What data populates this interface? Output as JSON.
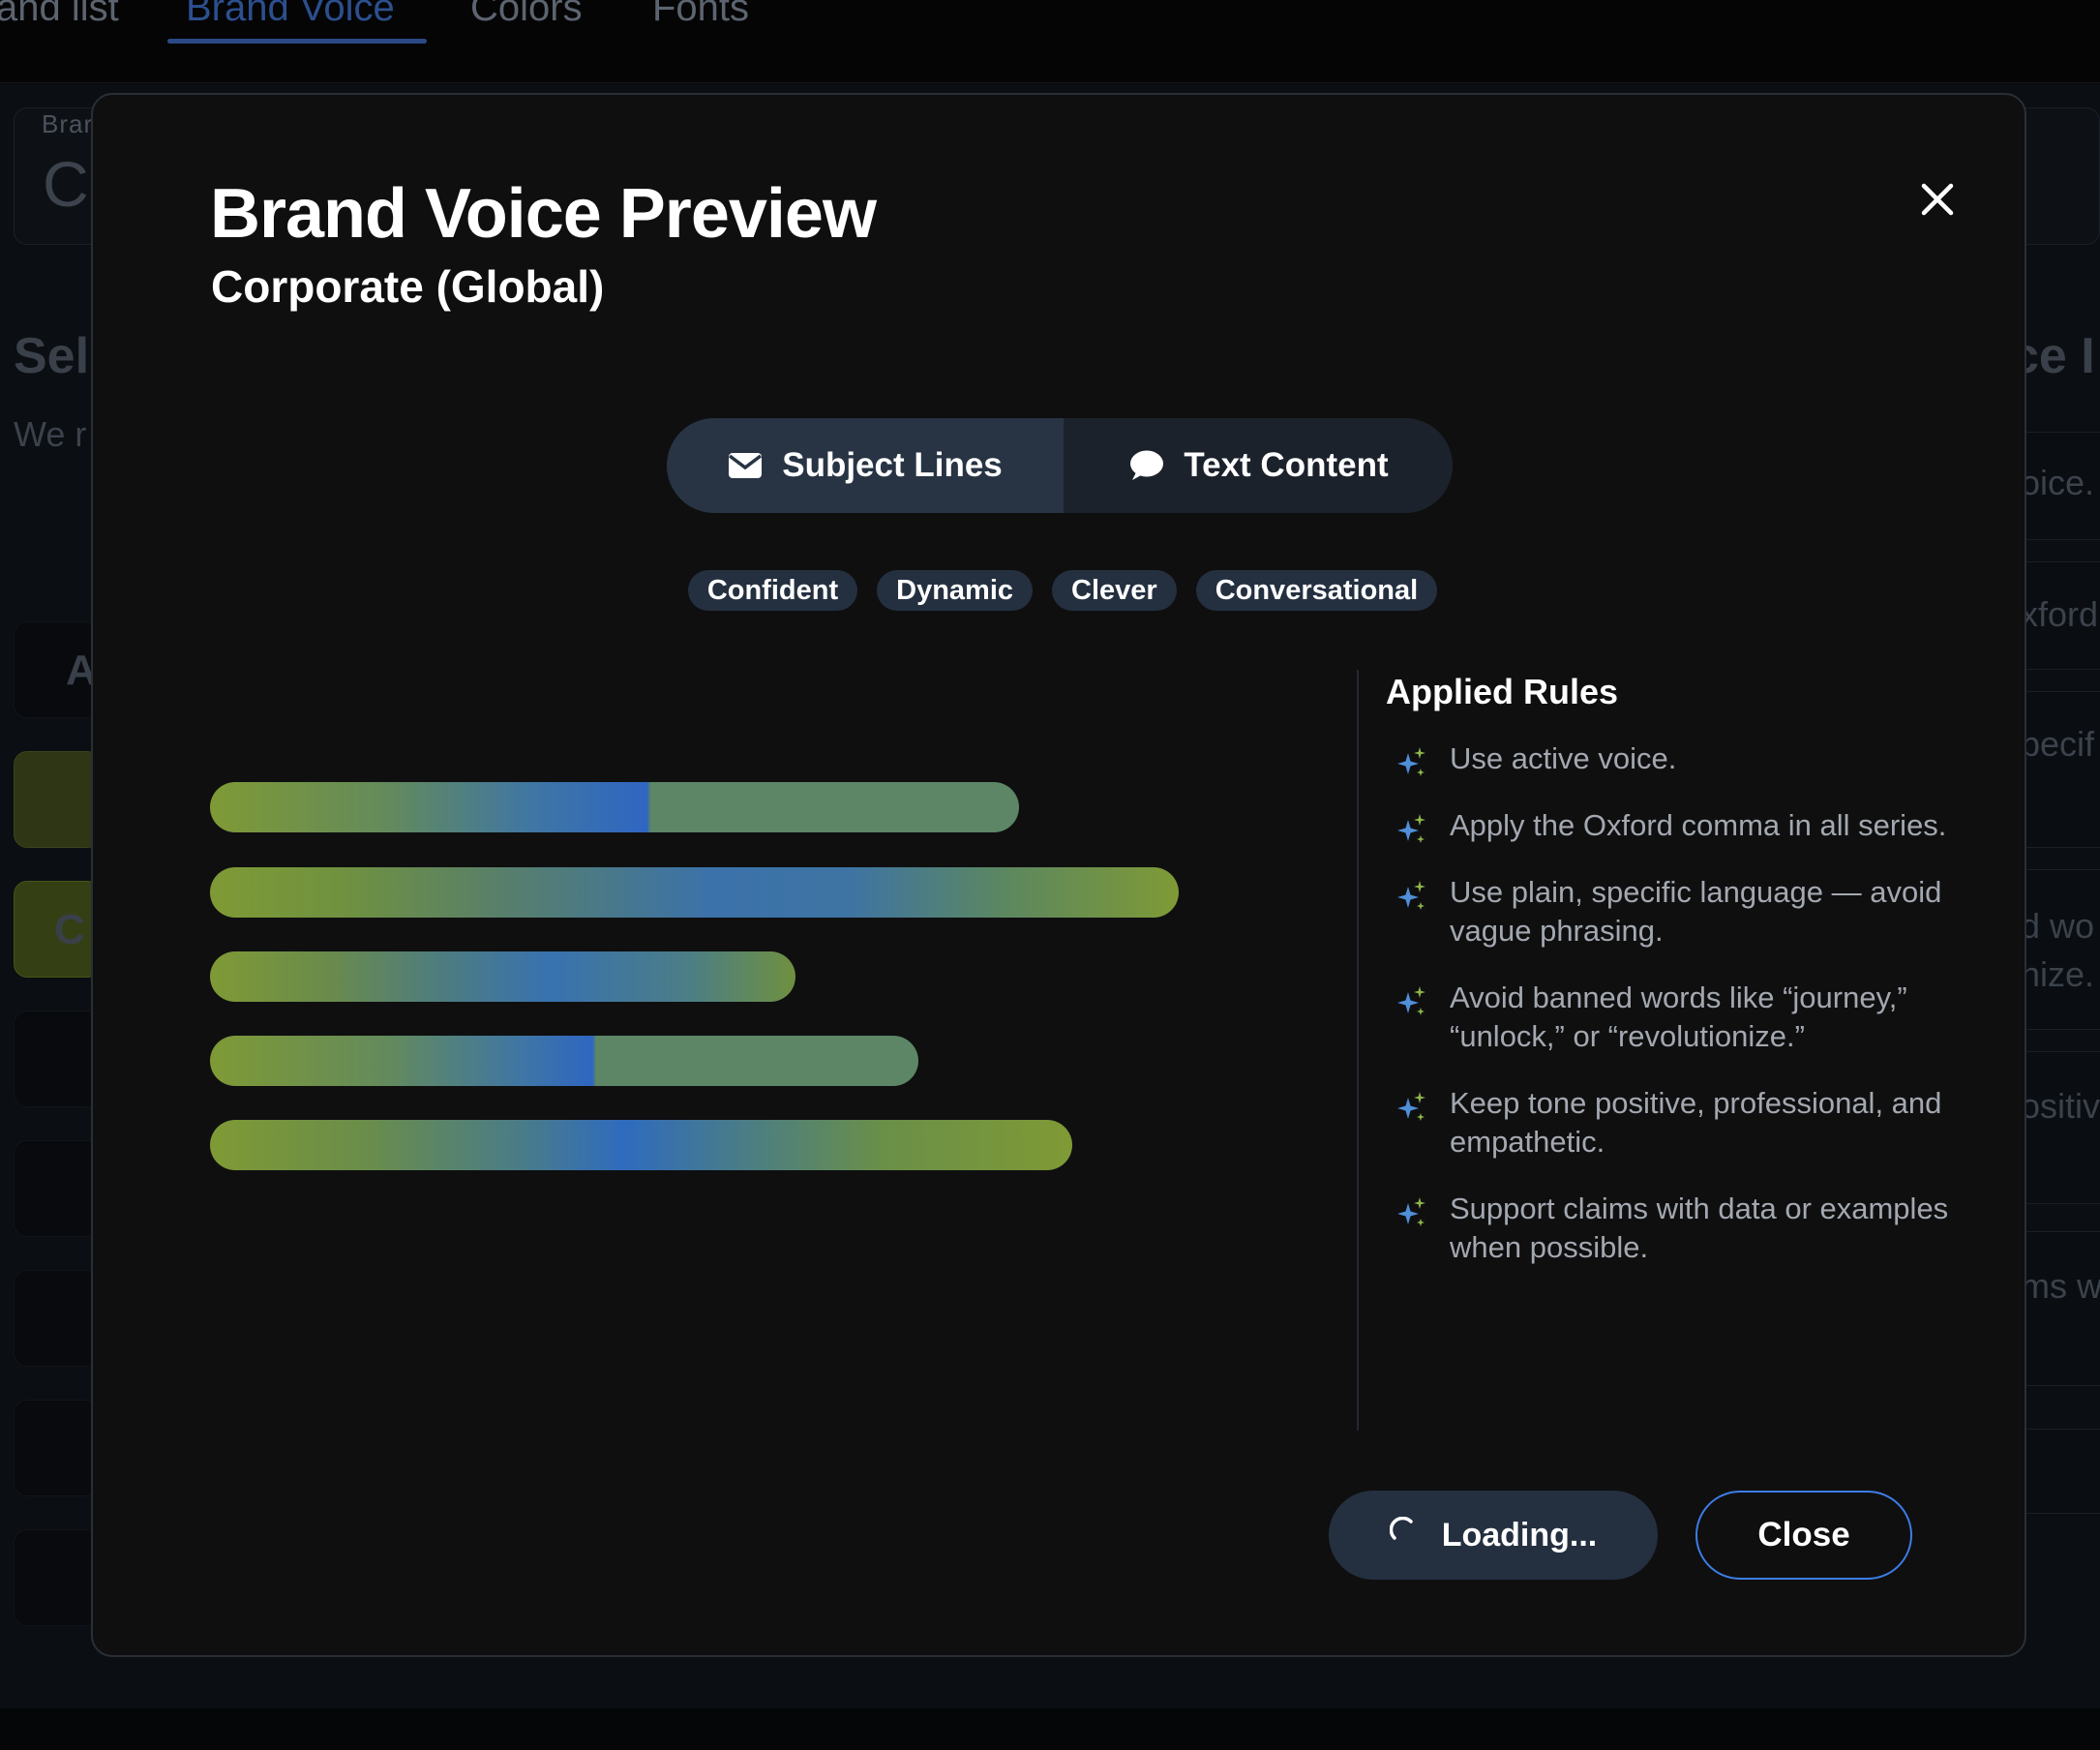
{
  "background": {
    "nav_tabs": [
      {
        "label": "and list"
      },
      {
        "label": "Brand Voice"
      },
      {
        "label": "Colors"
      },
      {
        "label": "Fonts"
      }
    ],
    "card_label": "Brar",
    "card_value": "C",
    "left_heading": "Sel",
    "left_text": "We r",
    "right_heading": "ce I",
    "list_letters": [
      "A",
      "C"
    ],
    "right_rows": [
      "oice.",
      "xford",
      "pecif",
      "d wo",
      "nize.",
      "ositiv",
      "ms w"
    ]
  },
  "modal": {
    "title": "Brand Voice Preview",
    "subtitle": "Corporate (Global)",
    "tabs": [
      {
        "label": "Subject Lines",
        "icon": "envelope-icon",
        "selected": true
      },
      {
        "label": "Text Content",
        "icon": "speech-bubble-icon",
        "selected": false
      }
    ],
    "chips": [
      "Confident",
      "Dynamic",
      "Clever",
      "Conversational"
    ],
    "skeleton_bars": [
      0.76,
      0.91,
      0.55,
      0.665,
      0.81
    ],
    "rules_title": "Applied Rules",
    "rules": [
      "Use active voice.",
      "Apply the Oxford comma in all series.",
      "Use plain, specific language — avoid vague phrasing.",
      "Avoid banned words like “journey,” “unlock,” or “revolutionize.”",
      "Keep tone positive, professional, and empathetic.",
      "Support claims with data or examples when possible."
    ],
    "loading_label": "Loading...",
    "close_label": "Close"
  },
  "colors": {
    "accent_blue": "#3d7de6",
    "bar_green": "#7f9a35",
    "bar_blue": "#2f6bbf",
    "modal_bg": "#0f0f10"
  }
}
